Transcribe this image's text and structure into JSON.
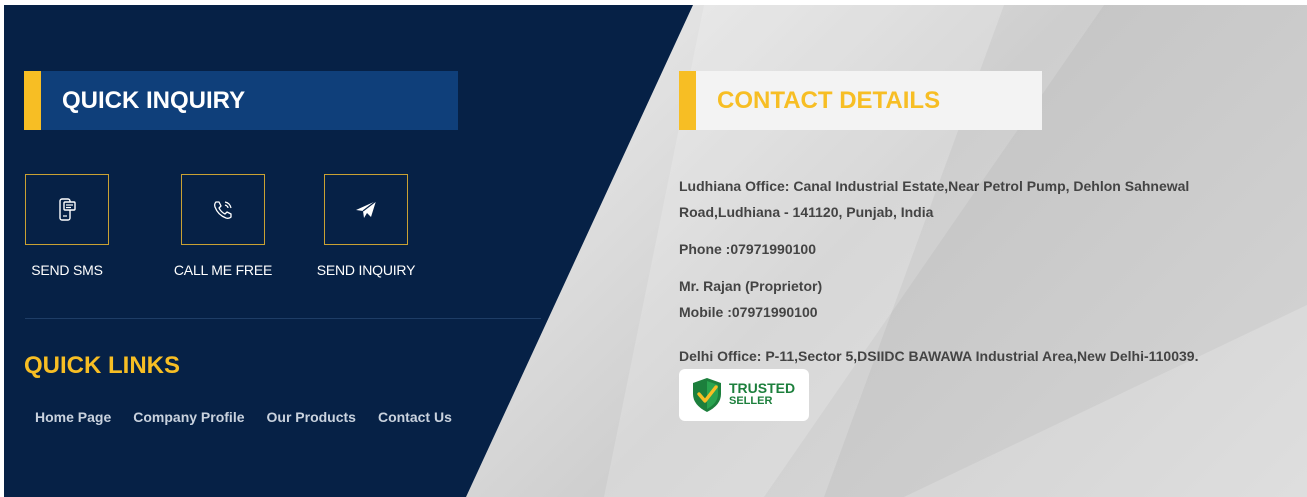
{
  "quick_inquiry": {
    "title": "QUICK INQUIRY",
    "actions": [
      {
        "label": "SEND SMS",
        "icon": "sms-icon"
      },
      {
        "label": "CALL ME FREE",
        "icon": "phone-icon"
      },
      {
        "label": "SEND INQUIRY",
        "icon": "paper-plane-icon"
      }
    ]
  },
  "quick_links": {
    "title": "QUICK LINKS",
    "items": [
      "Home Page",
      "Company Profile",
      "Our Products",
      "Contact Us"
    ]
  },
  "contact": {
    "title": "CONTACT DETAILS",
    "ludhiana_office": "Ludhiana Office: Canal Industrial Estate,Near Petrol Pump, Dehlon Sahnewal Road,Ludhiana - 141120, Punjab, India",
    "phone": "Phone :07971990100",
    "person": "Mr. Rajan (Proprietor)",
    "mobile": "Mobile :07971990100",
    "delhi_office": "Delhi Office: P-11,Sector 5,DSIIDC BAWAWA Industrial Area,New Delhi-110039."
  },
  "badge": {
    "line1": "TRUSTED",
    "line2": "SELLER"
  },
  "colors": {
    "navy": "#062146",
    "accent": "#f7be24",
    "heading_blue": "#0f3f7a",
    "badge_green": "#1c7f3c"
  }
}
